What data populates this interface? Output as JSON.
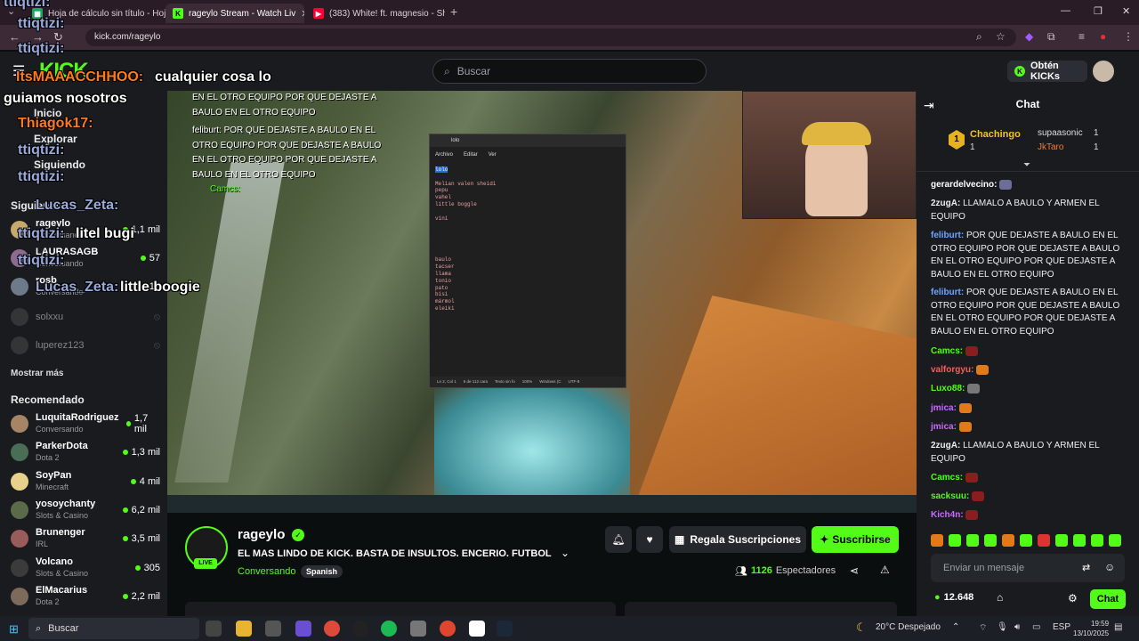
{
  "browser": {
    "tabs": [
      {
        "title": "Hoja de cálculo sin título - Hoj",
        "icon": "sheets-icon"
      },
      {
        "title": "rageylo Stream - Watch Liv",
        "icon": "kick-icon",
        "active": true
      },
      {
        "title": "(383) White! ft. magnesio - She",
        "icon": "youtube-icon"
      }
    ],
    "url": "kick.com/rageylo"
  },
  "header": {
    "search_placeholder": "Buscar",
    "kicks_label": "Obtén KICKs"
  },
  "sidebar": {
    "nav": [
      {
        "label": "Inicio"
      },
      {
        "label": "Explorar"
      },
      {
        "label": "Siguiendo"
      }
    ],
    "following_title": "Siguiendo",
    "following": [
      {
        "name": "rageylo",
        "sub": "Conversando",
        "viewers": "1,1 mil"
      },
      {
        "name": "LAURASAGB",
        "sub": "Conversando",
        "viewers": "57"
      },
      {
        "name": "rosb",
        "sub": "Conversando",
        "viewers": "13"
      },
      {
        "name": "solxxu",
        "sub": "",
        "viewers": ""
      },
      {
        "name": "luperez123",
        "sub": "",
        "viewers": ""
      }
    ],
    "show_more": "Mostrar más",
    "recommended_title": "Recomendado",
    "recommended": [
      {
        "name": "LuquitaRodriguez",
        "sub": "Conversando",
        "viewers": "1,7 mil"
      },
      {
        "name": "ParkerDota",
        "sub": "Dota 2",
        "viewers": "1,3 mil"
      },
      {
        "name": "SoyPan",
        "sub": "Minecraft",
        "viewers": "4 mil"
      },
      {
        "name": "yosoychanty",
        "sub": "Slots & Casino",
        "viewers": "6,2 mil"
      },
      {
        "name": "Brunenger",
        "sub": "IRL",
        "viewers": "3,5 mil"
      },
      {
        "name": "Volcano",
        "sub": "Slots & Casino",
        "viewers": "305"
      },
      {
        "name": "ElMacarius",
        "sub": "Dota 2",
        "viewers": "2,2 mil"
      }
    ]
  },
  "overlay": {
    "lines": [
      {
        "user": "ttiqtizi:",
        "text": ""
      },
      {
        "user": "ttiqtizi:",
        "text": ""
      },
      {
        "user": "ItsMAAACCHHOO:",
        "text": "cualquier cosa lo guiamos nosotros"
      },
      {
        "user": "Thiagok17:",
        "text": ""
      },
      {
        "user": "ttiqtizi:",
        "text": ""
      },
      {
        "user": "ttiqtizi:",
        "text": ""
      },
      {
        "user": "Lucas_Zeta:",
        "text": ""
      },
      {
        "user": "ttiqtizi:",
        "text": "litel bugi"
      },
      {
        "user": "ttiqtizi:",
        "text": ""
      },
      {
        "user": "Lucas_Zeta:",
        "text": "little boogie"
      }
    ],
    "stream_chat": [
      "EN EL OTRO EQUIPO POR QUE DEJASTE A",
      "BAULO EN EL OTRO EQUIPO",
      "feliburt: POR QUE DEJASTE A BAULO EN EL",
      "OTRO EQUIPO POR QUE DEJASTE A BAULO",
      "EN EL OTRO EQUIPO POR QUE DEJASTE A",
      "BAULO EN EL OTRO EQUIPO",
      "Camcs:"
    ]
  },
  "notepad": {
    "tab": "lolo",
    "menu": [
      "Archivo",
      "Editar",
      "Ver"
    ],
    "lines": [
      "lolo",
      "",
      "Melian valen sheidi",
      "pepu",
      "vahel",
      "little boggle",
      "",
      "vini",
      "",
      "",
      "",
      "",
      "",
      "baulo",
      "tacser",
      "llama",
      "tonio",
      "pato",
      "bisi",
      "mármol",
      "eleiki"
    ],
    "status": [
      "Ln 2, Col 1",
      "6 de 112 cara",
      "Texto sin fo",
      "100%",
      "Windows (C",
      "UTF-8"
    ]
  },
  "stream_info": {
    "channel": "rageylo",
    "live": "LIVE",
    "title": "EL MAS LINDO DE KICK. BASTA DE INSULTOS. ENCERIO. FUTBOL VS ...",
    "category": "Conversando",
    "language": "Spanish",
    "viewers": "1126",
    "viewers_label": "Espectadores",
    "gift_label": "Regala Suscripciones",
    "subscribe_label": "Suscribirse"
  },
  "chat": {
    "title": "Chat",
    "leaderboard": [
      {
        "name": "Chachingo",
        "count": "1",
        "rank": "1"
      },
      {
        "name": "supaasonic",
        "count": "1",
        "rank": ""
      },
      {
        "name": "JkTaro",
        "count": "1",
        "rank": ""
      }
    ],
    "messages": [
      {
        "user": "gerardelvecino:",
        "color": "#ffffff",
        "text": ""
      },
      {
        "user": "2zugA:",
        "color": "#ffffff",
        "text": "LLAMALO A BAULO Y ARMEN EL EQUIPO"
      },
      {
        "user": "feliburt:",
        "color": "#6ea6ff",
        "text": "POR QUE DEJASTE A BAULO EN EL OTRO EQUIPO POR QUE DEJASTE A BAULO EN EL OTRO EQUIPO POR QUE DEJASTE A BAULO EN EL OTRO EQUIPO"
      },
      {
        "user": "feliburt:",
        "color": "#6ea6ff",
        "text": "POR QUE DEJASTE A BAULO EN EL OTRO EQUIPO POR QUE DEJASTE A BAULO EN EL OTRO EQUIPO POR QUE DEJASTE A BAULO EN EL OTRO EQUIPO"
      },
      {
        "user": "Camcs:",
        "color": "#53fc18",
        "text": ""
      },
      {
        "user": "valforgyu:",
        "color": "#ff5a5a",
        "text": ""
      },
      {
        "user": "Luxo88:",
        "color": "#53fc18",
        "text": ""
      },
      {
        "user": "jmica:",
        "color": "#c86bff",
        "text": ""
      },
      {
        "user": "jmica:",
        "color": "#c86bff",
        "text": ""
      },
      {
        "user": "2zugA:",
        "color": "#ffffff",
        "text": "LLAMALO A BAULO Y ARMEN EL EQUIPO"
      },
      {
        "user": "Camcs:",
        "color": "#53fc18",
        "text": ""
      },
      {
        "user": "sacksuu:",
        "color": "#53fc18",
        "text": ""
      },
      {
        "user": "Kich4n:",
        "color": "#c86bff",
        "text": ""
      }
    ],
    "input_placeholder": "Enviar un mensaje",
    "kicks_balance": "12.648",
    "send_label": "Chat"
  },
  "windows": {
    "search": "Buscar",
    "weather": "20°C  Despejado",
    "lang": "ESP",
    "time": "19:59",
    "date": "13/10/2025"
  },
  "colors": {
    "kick_green": "#53fc18",
    "panel": "#191b1f",
    "background": "#0b0e0f"
  }
}
